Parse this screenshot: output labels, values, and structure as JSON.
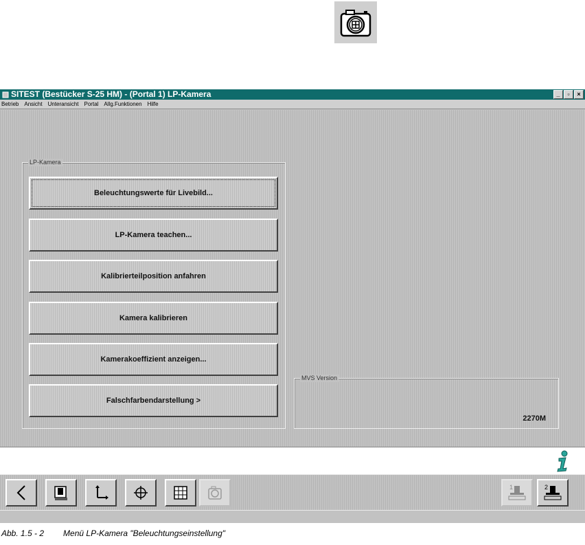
{
  "window": {
    "title": "SITEST (Bestücker S-25 HM) - (Portal 1) LP-Kamera",
    "controls": [
      "_",
      "▫",
      "×"
    ]
  },
  "menubar": {
    "items": [
      "Betrieb",
      "Ansicht",
      "Unteransicht",
      "Portal",
      "Allg.Funktionen",
      "Hilfe"
    ]
  },
  "lp_kamera_group": {
    "label": "LP-Kamera",
    "buttons": [
      "Beleuchtungswerte für Livebild...",
      "LP-Kamera teachen...",
      "Kalibrierteilposition anfahren",
      "Kamera kalibrieren",
      "Kamerakoeffizient anzeigen...",
      "Falschfarbendarstellung >"
    ]
  },
  "mvs_group": {
    "label": "MVS Version",
    "value": "2270M"
  },
  "toolbar": {
    "buttons": [
      {
        "name": "back-arrow-icon",
        "enabled": true
      },
      {
        "name": "placement-head-icon",
        "enabled": true
      },
      {
        "name": "axes-icon",
        "enabled": true
      },
      {
        "name": "crosshair-icon",
        "enabled": true
      },
      {
        "name": "grid-icon",
        "enabled": true
      },
      {
        "name": "camera-icon",
        "enabled": false
      },
      {
        "name": "portal-1-icon",
        "enabled": false
      },
      {
        "name": "portal-2-icon",
        "enabled": true
      }
    ],
    "portal1_label": "1",
    "portal2_label": "2"
  },
  "caption": {
    "figure": "Abb. 1.5 - 2",
    "text": "Menü LP-Kamera \"Beleuchtungseinstellung\""
  },
  "colors": {
    "titlebar": "#0f6b6b",
    "info_icon": "#2aa59a"
  }
}
